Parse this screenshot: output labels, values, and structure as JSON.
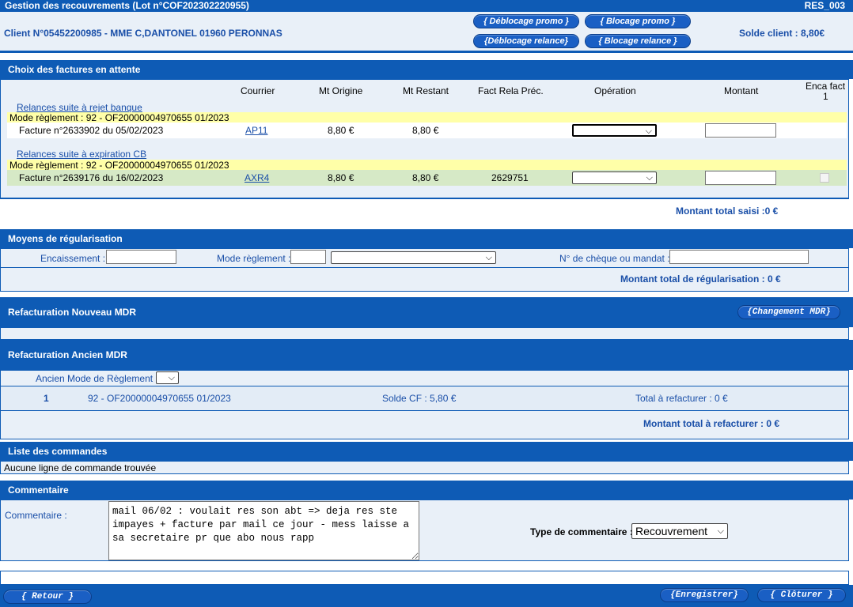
{
  "header": {
    "title": "Gestion des recouvrements (Lot n°COF202302220955)",
    "code": "RES_003",
    "client": "Client N°05452200985 - MME C,DANTONEL 01960 PERONNAS",
    "solde": "Solde client : 8,80€",
    "buttons": {
      "deblocage_promo": "{ Déblocage promo }",
      "blocage_promo": "{ Blocage promo }",
      "deblocage_relance": "{Déblocage relance}",
      "blocage_relance": "{ Blocage relance }"
    }
  },
  "factures": {
    "title": "Choix des factures en attente",
    "columns": {
      "courrier": "Courrier",
      "mt_origine": "Mt Origine",
      "mt_restant": "Mt Restant",
      "fact_rela": "Fact Rela Préc.",
      "operation": "Opération",
      "montant": "Montant",
      "enca_fact": "Enca fact",
      "enca_num": "1"
    },
    "groups": [
      {
        "label": "Relances suite à rejet banque",
        "mode": "Mode règlement : 92 - OF20000004970655 01/2023",
        "facture": "Facture n°2633902 du 05/02/2023",
        "courrier": "AP11",
        "mt_origine": "8,80 €",
        "mt_restant": "8,80 €",
        "fact_rela": ""
      },
      {
        "label": "Relances suite à expiration CB",
        "mode": "Mode règlement : 92 - OF20000004970655 01/2023",
        "facture": "Facture n°2639176 du 16/02/2023",
        "courrier": "AXR4",
        "mt_origine": "8,80 €",
        "mt_restant": "8,80 €",
        "fact_rela": "2629751"
      }
    ],
    "total": "Montant total saisi :0 €"
  },
  "moyens": {
    "title": "Moyens de régularisation",
    "encaissement_label": "Encaissement :",
    "mode_label": "Mode règlement :",
    "cheque_label": "N° de chèque ou mandat :",
    "total": "Montant total de régularisation : 0 €"
  },
  "nouveau_mdr": {
    "title": "Refacturation Nouveau MDR",
    "button": "{Changement MDR}"
  },
  "ancien_mdr": {
    "title": "Refacturation Ancien MDR",
    "label": "Ancien Mode de Règlement :",
    "row": {
      "num": "1",
      "mode": "92 - OF20000004970655 01/2023",
      "solde": "Solde CF : 5,80 €",
      "total": "Total à refacturer : 0 €"
    },
    "total": "Montant total à refacturer : 0 €"
  },
  "commandes": {
    "title": "Liste des commandes",
    "empty": "Aucune ligne de commande trouvée"
  },
  "commentaire": {
    "title": "Commentaire",
    "label": "Commentaire :",
    "text": "mail 06/02 : voulait res son abt => deja res ste impayes + facture par mail ce jour - mess laisse a sa secretaire pr que abo nous rapp",
    "type_label": "Type de commentaire :",
    "type_value": "Recouvrement"
  },
  "footer": {
    "retour": "{ Retour }",
    "enregistrer": "{Enregistrer}",
    "cloturer": "{ Clôturer }"
  },
  "colors": {
    "band": "#0e5bb5",
    "text_blue": "#1a4fa8",
    "highlight": "#ffffa8",
    "row_green": "#d6e9c6"
  }
}
